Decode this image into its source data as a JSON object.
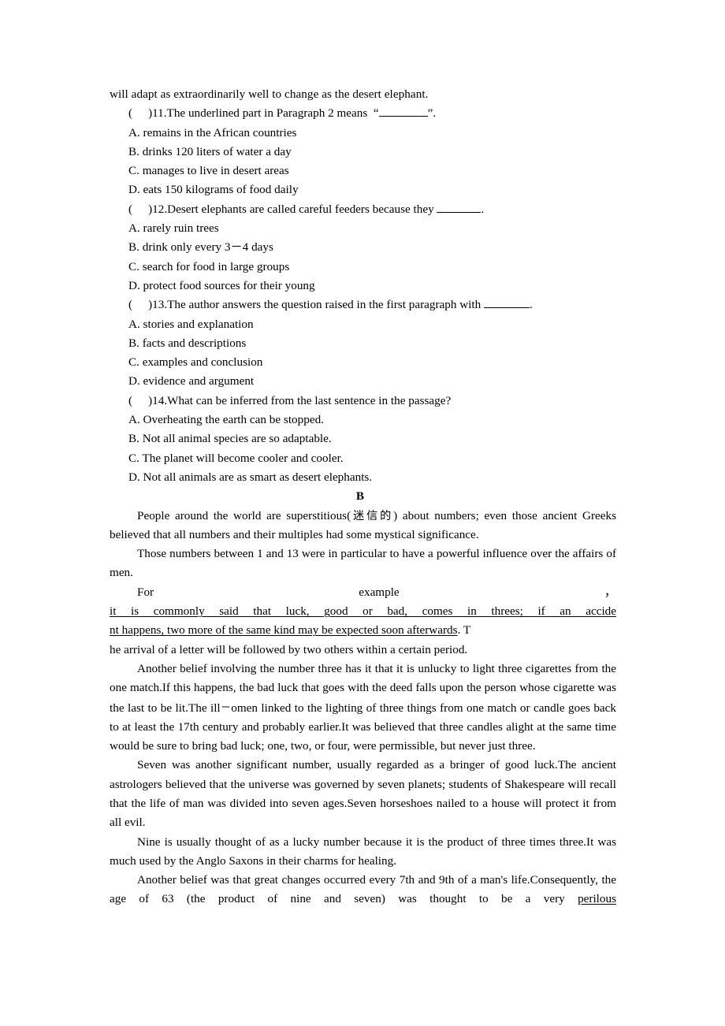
{
  "document": {
    "top_line": "will adapt as extraordinarily well to change as the desert elephant.",
    "questions": [
      {
        "marker_open": "(",
        "marker_close": ")",
        "number": "11.",
        "stem_before": "The underlined part in Paragraph 2 means",
        "quote_open": "“",
        "quote_close": "”",
        "stem_after": ".",
        "options": [
          "A. remains in the African countries",
          "B. drinks 120 liters of water a day",
          "C. manages to live in desert areas",
          "D. eats 150 kilograms of food daily"
        ]
      },
      {
        "marker_open": "(",
        "marker_close": ")",
        "number": "12.",
        "stem_before": "Desert elephants are called careful feeders because they",
        "stem_after": ".",
        "options": [
          "A. rarely ruin trees",
          "B. drink only every 3－4 days",
          "C. search for food in large groups",
          "D. protect food sources for their young"
        ]
      },
      {
        "marker_open": "(",
        "marker_close": ")",
        "number": "13.",
        "stem_before": "The author answers the question raised in the first paragraph with",
        "stem_after": ".",
        "options": [
          "A. stories and explanation",
          "B. facts and descriptions",
          "C. examples and conclusion",
          "D. evidence and argument"
        ]
      },
      {
        "marker_open": "(",
        "marker_close": ")",
        "number": "14.",
        "stem_before": "What can be inferred from the last sentence in the passage?",
        "stem_after": "",
        "options": [
          "A. Overheating the earth can be stopped.",
          "B. Not all animal species are so adaptable.",
          "C. The planet will become cooler and cooler.",
          "D. Not all animals are as smart as desert elephants."
        ]
      }
    ],
    "section_heading": "B",
    "passage": {
      "p1": "People around the world are superstitious(迷信的) about numbers; even those ancient Greeks believed that all numbers and their multiples had some mystical significance.",
      "p1_pre_cjk": "People around the world are superstitious(",
      "p1_cjk": "迷信的",
      "p1_post_cjk": ") about numbers; even those ancient Greeks believed that all numbers and their multiples had some mystical significance.",
      "p2": "Those numbers between 1 and 13 were in particular to have a powerful influence over the affairs of men.",
      "spread": {
        "word1": "For",
        "word2": "example",
        "word3": "，"
      },
      "underlined_line1": "it is commonly said that luck, good or bad, comes in threes; if an accide",
      "underlined_line2": "nt happens, two more of the same kind may be expected soon afterwards",
      "after_underline": ". T",
      "p3_tail": "he arrival of a letter will be followed by two others within a certain period.",
      "p4_a": "Another belief involving the number three has it that it is unlucky to light three cigarettes from the one match.If this happens, the bad luck that goes with the deed falls upon the person whose cigarette was the last to be lit.The ill",
      "p4_dash": "－",
      "p4_b": "omen linked to the lighting of three things from one match or candle goes back to at least the 17th century and probably earlier.It was believed that three candles alight at the same time would be sure to bring bad luck; one, two, or four, were permissible, but never just three.",
      "p5": "Seven was another significant number, usually regarded as a bringer of good luck.The ancient astrologers believed that the universe was governed by seven planets; students of Shakespeare will recall that the life of man was divided into seven ages.Seven horseshoes nailed to a house will protect it from all evil.",
      "p6": "Nine is usually thought of as a lucky number because it is the product of three times three.It was much used by the Anglo Saxons in their charms for healing.",
      "p7_a": "Another belief was that great changes occurred every 7th and 9th of a man's life.Consequently, the age of 63 (the product of nine and seven) was thought to be a very ",
      "p7_underlined": "perilous"
    }
  }
}
